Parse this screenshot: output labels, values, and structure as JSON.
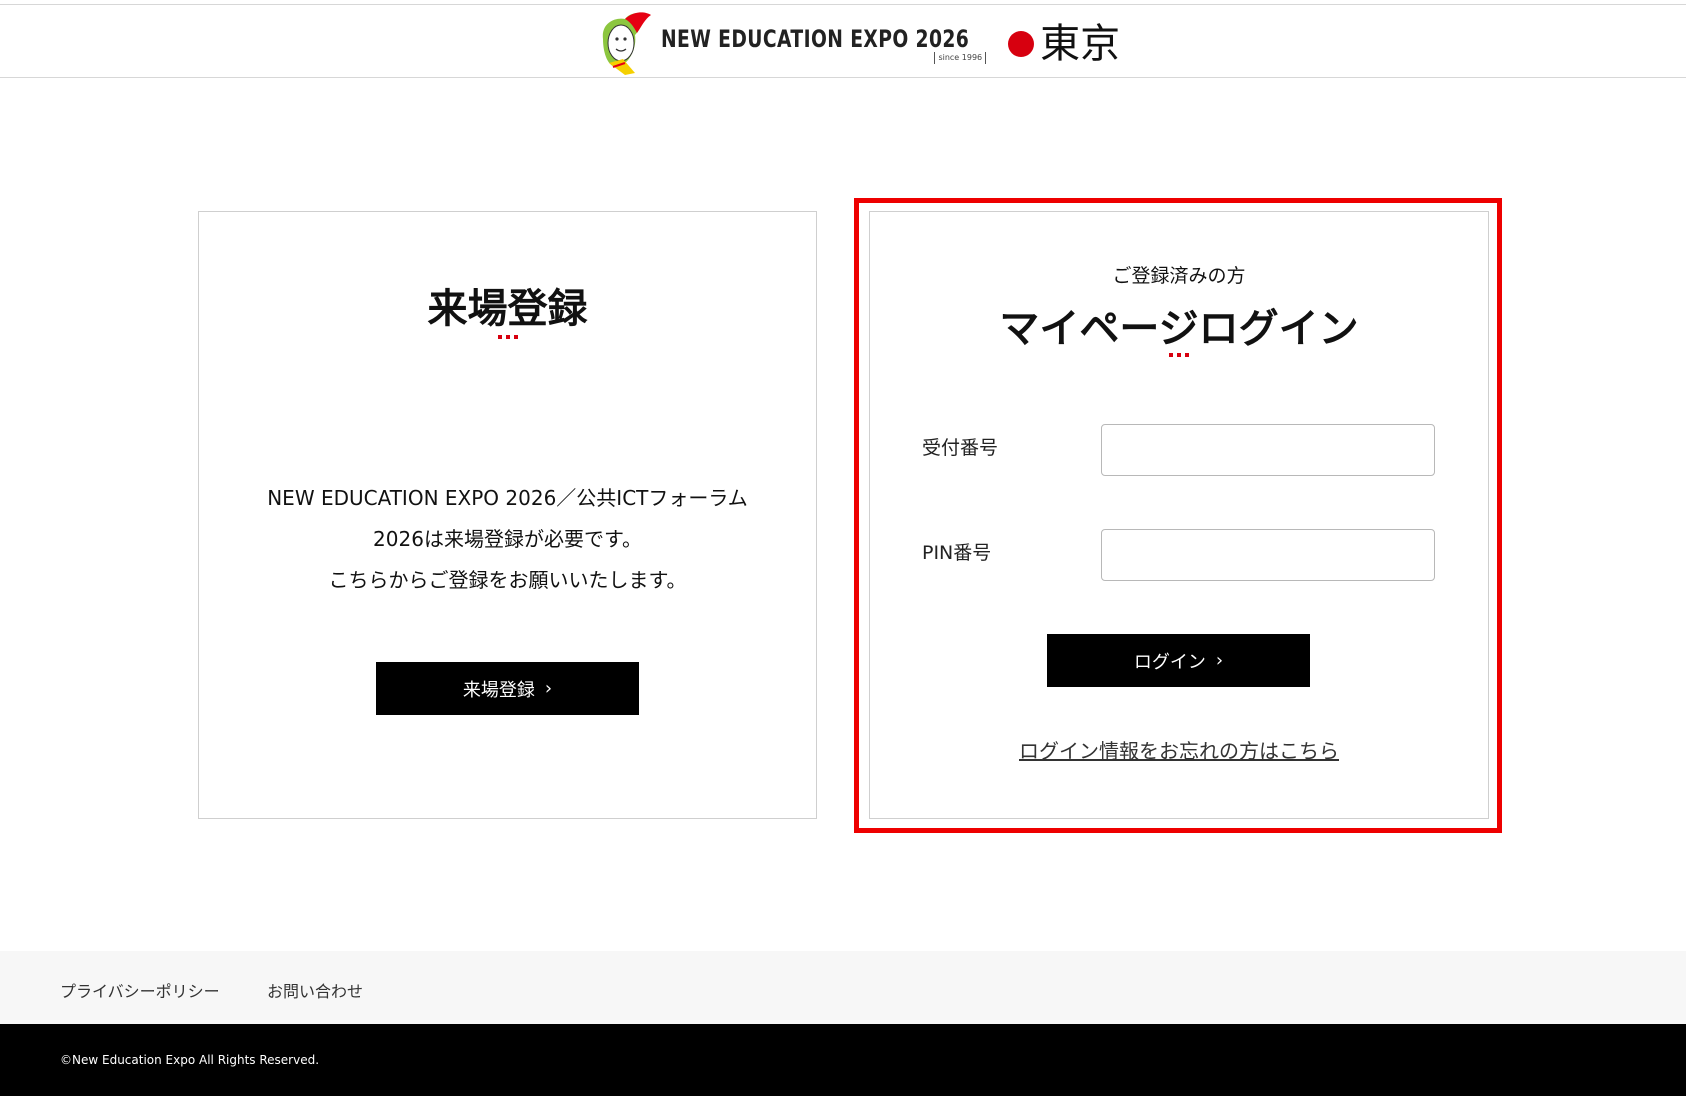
{
  "header": {
    "brand_name": "NEW EDUCATION EXPO 2026",
    "since": "since 1996",
    "city": "東京",
    "accent_color": "#d7000f"
  },
  "registration": {
    "title": "来場登録",
    "description_lines": [
      "NEW EDUCATION EXPO 2026／公共ICTフォーラム",
      "2026は来場登録が必要です。",
      "こちらからご登録をお願いいたします。"
    ],
    "button_label": "来場登録",
    "button_icon": "chevron-right-icon"
  },
  "login": {
    "subtitle": "ご登録済みの方",
    "title": "マイページログイン",
    "receipt_label": "受付番号",
    "receipt_value": "",
    "pin_label": "PIN番号",
    "pin_value": "",
    "button_label": "ログイン",
    "button_icon": "chevron-right-icon",
    "forgot_link": "ログイン情報をお忘れの方はこちら",
    "highlight_color": "#ee0000"
  },
  "footer": {
    "links": [
      "プライバシーポリシー",
      "お問い合わせ"
    ],
    "copyright": "©New Education Expo All Rights Reserved."
  }
}
